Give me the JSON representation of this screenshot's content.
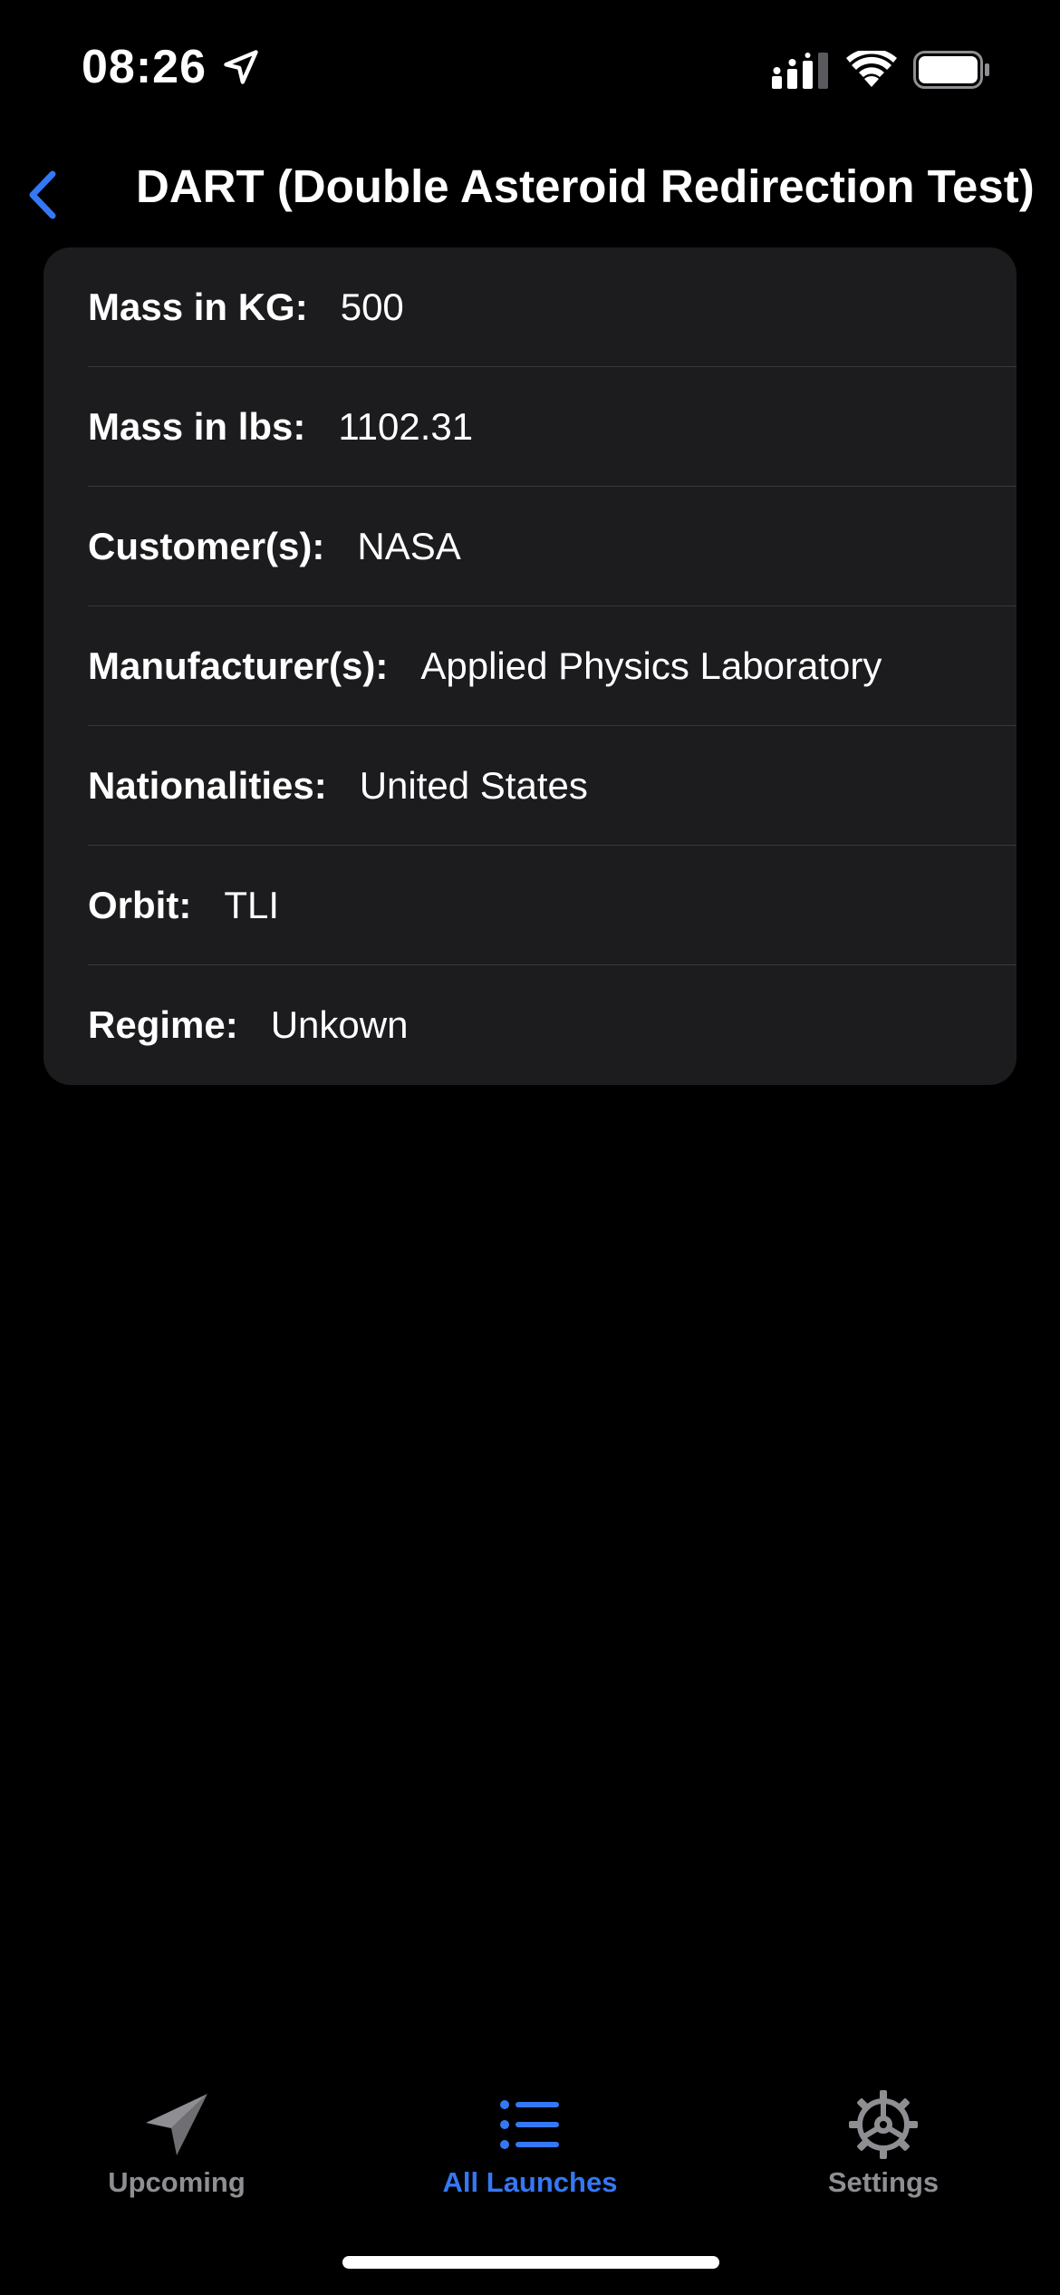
{
  "status_bar": {
    "time": "08:26"
  },
  "nav": {
    "title": "DART (Double Asteroid Redirection Test)",
    "back_icon": "chevron-left-icon"
  },
  "details": [
    {
      "label": "Mass in KG:",
      "value": "500"
    },
    {
      "label": "Mass in lbs:",
      "value": "1102.31"
    },
    {
      "label": "Customer(s):",
      "value": "NASA"
    },
    {
      "label": "Manufacturer(s):",
      "value": "Applied Physics Laboratory"
    },
    {
      "label": "Nationalities:",
      "value": "United States"
    },
    {
      "label": "Orbit:",
      "value": "TLI"
    },
    {
      "label": "Regime:",
      "value": "Unkown"
    }
  ],
  "tab_bar": {
    "tabs": [
      {
        "label": "Upcoming",
        "icon": "paper-plane-icon",
        "active": false
      },
      {
        "label": "All Launches",
        "icon": "list-icon",
        "active": true
      },
      {
        "label": "Settings",
        "icon": "gear-icon",
        "active": false
      }
    ]
  },
  "colors": {
    "accent": "#3478f6",
    "background": "#000000",
    "card": "#1c1c1e",
    "inactive": "#8e8e93"
  }
}
